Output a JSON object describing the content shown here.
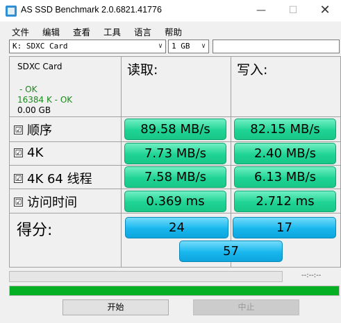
{
  "window": {
    "title": "AS SSD Benchmark 2.0.6821.41776",
    "minimize": "—",
    "maximize": "☐",
    "close": "✕"
  },
  "menu": [
    "文件",
    "编辑",
    "查看",
    "工具",
    "语言",
    "帮助"
  ],
  "selectors": {
    "drive": "K: SDXC Card",
    "size": "1 GB",
    "extra": ""
  },
  "drive_info": {
    "name": "SDXC Card",
    "status1": " - OK",
    "status2": "16384 K - OK",
    "capacity": "0.00 GB"
  },
  "columns": {
    "read": "读取:",
    "write": "写入:"
  },
  "rows": [
    {
      "label": "顺序",
      "checked": "☑",
      "read": "89.58 MB/s",
      "write": "82.15 MB/s"
    },
    {
      "label": "4K",
      "checked": "☑",
      "read": "7.73 MB/s",
      "write": "2.40 MB/s"
    },
    {
      "label": "4K 64 线程",
      "checked": "☑",
      "read": "7.58 MB/s",
      "write": "6.13 MB/s"
    },
    {
      "label": "访问时间",
      "checked": "☑",
      "read": "0.369 ms",
      "write": "2.712 ms"
    }
  ],
  "score": {
    "label": "得分:",
    "read": "24",
    "write": "17",
    "total": "57"
  },
  "progress": {
    "time": "--:--:--",
    "total_fraction": 1.0
  },
  "buttons": {
    "start": "开始",
    "stop": "中止"
  },
  "colors": {
    "result_green": "#1fd495",
    "score_blue": "#18b7ee",
    "progress_green": "#06b025",
    "ok_text": "#1a8a1a"
  }
}
